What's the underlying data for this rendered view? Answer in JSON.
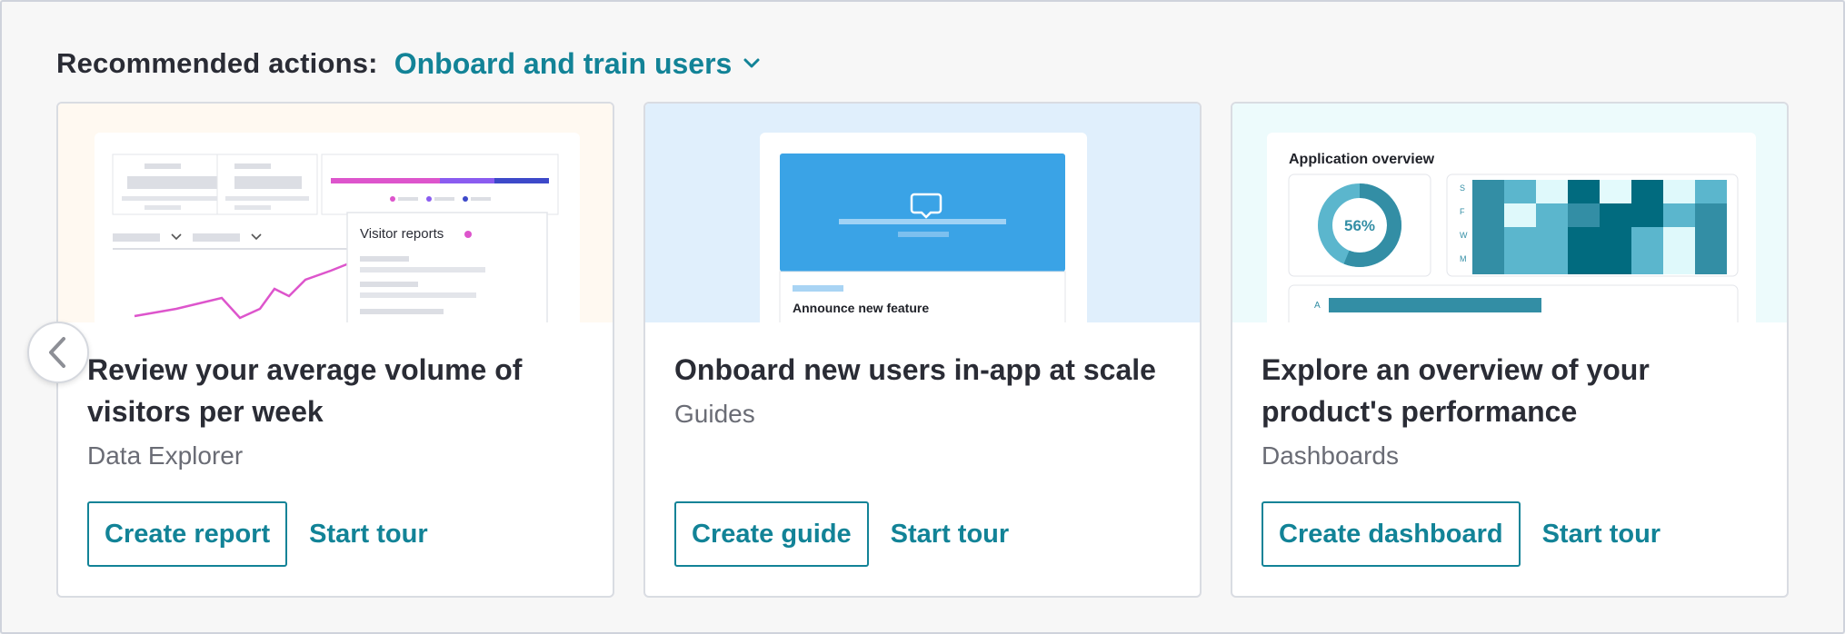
{
  "header": {
    "title": "Recommended actions:",
    "select_value": "Onboard and train users"
  },
  "colors": {
    "accent": "#128397",
    "text": "#2a2c35",
    "muted": "#6a6c75"
  },
  "cards": [
    {
      "preview": {
        "panel_title": "Visitor reports"
      },
      "title": "Review your average volume of visitors per week",
      "subtitle": "Data Explorer",
      "primary_label": "Create report",
      "secondary_label": "Start tour"
    },
    {
      "preview": {
        "panel_title": "Announce new feature"
      },
      "title": "Onboard new users in-app at scale",
      "subtitle": "Guides",
      "primary_label": "Create guide",
      "secondary_label": "Start tour"
    },
    {
      "preview": {
        "panel_title": "Application overview",
        "donut_value": "56%",
        "heatmap_rows": [
          "S",
          "F",
          "W",
          "M"
        ],
        "bar_label": "A"
      },
      "title": "Explore an overview of your product's performance",
      "subtitle": "Dashboards",
      "primary_label": "Create dashboard",
      "secondary_label": "Start tour"
    }
  ],
  "carousel": {
    "prev_icon": "chevron-left-icon"
  }
}
